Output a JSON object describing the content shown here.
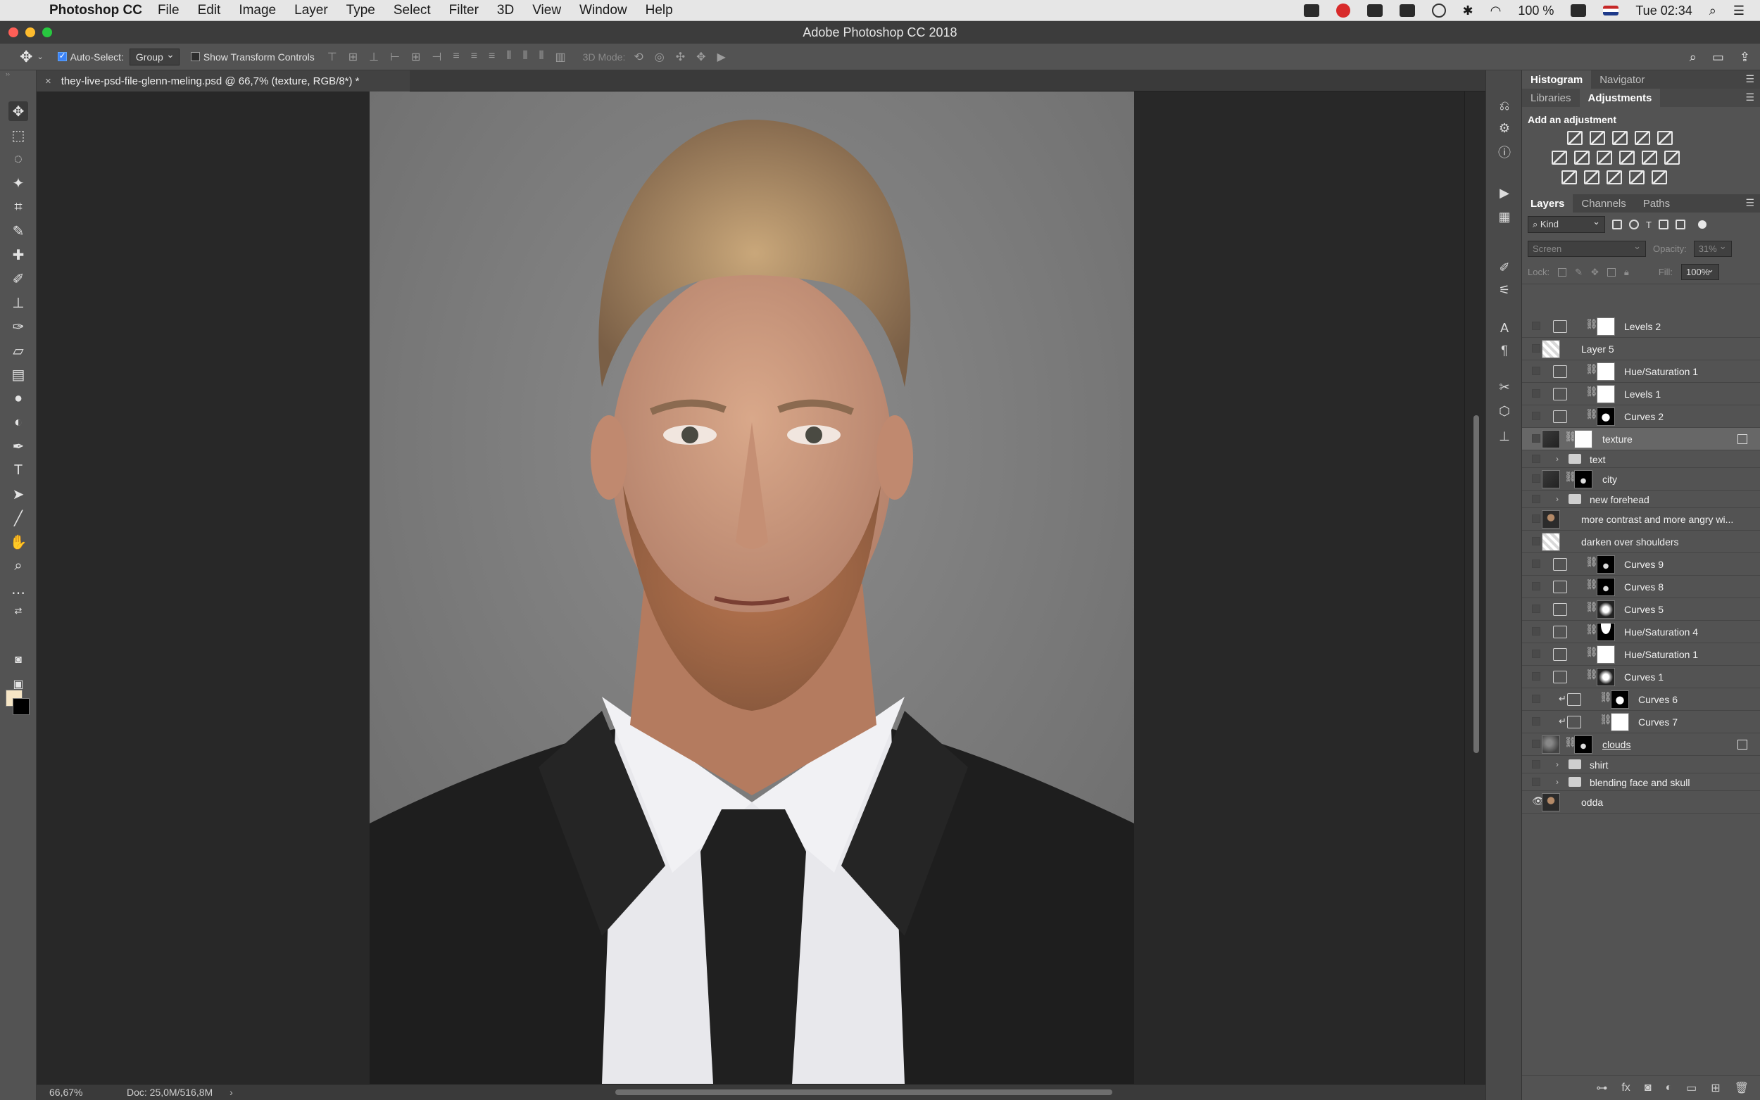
{
  "menubar": {
    "app_name": "Photoshop CC",
    "items": [
      "File",
      "Edit",
      "Image",
      "Layer",
      "Type",
      "Select",
      "Filter",
      "3D",
      "View",
      "Window",
      "Help"
    ],
    "battery": "100 %",
    "clock": "Tue 02:34"
  },
  "window": {
    "title": "Adobe Photoshop CC 2018"
  },
  "options_bar": {
    "auto_select_label": "Auto-Select:",
    "auto_select_checked": true,
    "auto_select_value": "Group",
    "show_transform_label": "Show Transform Controls",
    "show_transform_checked": false,
    "mode_3d_label": "3D Mode:"
  },
  "document": {
    "tab_label": "they-live-psd-file-glenn-meling.psd @ 66,7% (texture, RGB/8*) *"
  },
  "status": {
    "zoom": "66,67%",
    "doc_size": "Doc: 25,0M/516,8M"
  },
  "panels": {
    "top_tabs": [
      "Histogram",
      "Navigator"
    ],
    "mid_tabs": [
      "Libraries",
      "Adjustments"
    ],
    "adjustments_title": "Add an adjustment",
    "layers_tabs": [
      "Layers",
      "Channels",
      "Paths"
    ],
    "filter_kind": "Kind",
    "blend_mode": "Screen",
    "opacity_label": "Opacity:",
    "opacity_value": "31%",
    "lock_label": "Lock:",
    "fill_label": "Fill:",
    "fill_value": "100%"
  },
  "layers": [
    {
      "name": "Levels 2",
      "type": "adjustment",
      "icon": "levels-icon",
      "mask": "white",
      "visible": false,
      "selected": false
    },
    {
      "name": "Layer 5",
      "type": "pixel",
      "thumb": "light",
      "visible": false,
      "selected": false
    },
    {
      "name": "Hue/Saturation 1",
      "type": "adjustment",
      "icon": "hue-saturation-icon",
      "mask": "white",
      "visible": false,
      "selected": false
    },
    {
      "name": "Levels 1",
      "type": "adjustment",
      "icon": "levels-icon",
      "mask": "white",
      "visible": false,
      "selected": false
    },
    {
      "name": "Curves 2",
      "type": "adjustment",
      "icon": "curves-icon",
      "mask": "dark",
      "visible": false,
      "selected": false
    },
    {
      "name": "texture",
      "type": "smart",
      "visible": false,
      "selected": true
    },
    {
      "name": "text",
      "type": "group",
      "visible": false,
      "selected": false
    },
    {
      "name": "city",
      "type": "pixel-masked",
      "visible": false,
      "selected": false
    },
    {
      "name": "new forehead",
      "type": "group",
      "visible": false,
      "selected": false
    },
    {
      "name": "more contrast and more angry wi...",
      "type": "pixel",
      "thumb": "portrait",
      "visible": false,
      "selected": false
    },
    {
      "name": "darken over shoulders",
      "type": "pixel",
      "thumb": "light",
      "visible": false,
      "selected": false
    },
    {
      "name": "Curves 9",
      "type": "adjustment",
      "icon": "curves-icon",
      "mask": "darker",
      "visible": false,
      "selected": false
    },
    {
      "name": "Curves 8",
      "type": "adjustment",
      "icon": "curves-icon",
      "mask": "darker",
      "visible": false,
      "selected": false
    },
    {
      "name": "Curves 5",
      "type": "adjustment",
      "icon": "curves-icon",
      "mask": "soft",
      "visible": false,
      "selected": false
    },
    {
      "name": "Hue/Saturation 4",
      "type": "adjustment",
      "icon": "hue-saturation-icon",
      "mask": "top",
      "visible": false,
      "selected": false
    },
    {
      "name": "Hue/Saturation 1",
      "type": "adjustment",
      "icon": "hue-saturation-icon",
      "mask": "white",
      "visible": false,
      "selected": false
    },
    {
      "name": "Curves 1",
      "type": "adjustment",
      "icon": "curves-icon",
      "mask": "soft",
      "visible": false,
      "selected": false
    },
    {
      "name": "Curves 6",
      "type": "adjustment-clipped",
      "icon": "curves-icon",
      "mask": "dark",
      "visible": false,
      "selected": false
    },
    {
      "name": "Curves 7",
      "type": "adjustment-clipped",
      "icon": "curves-icon",
      "mask": "white",
      "visible": false,
      "selected": false
    },
    {
      "name": "clouds",
      "type": "smart-masked",
      "visible": false,
      "selected": false
    },
    {
      "name": "shirt",
      "type": "group",
      "visible": false,
      "selected": false
    },
    {
      "name": "blending face and skull",
      "type": "group",
      "visible": false,
      "selected": false
    },
    {
      "name": "odda",
      "type": "pixel",
      "thumb": "portrait",
      "visible": true,
      "selected": false
    }
  ]
}
